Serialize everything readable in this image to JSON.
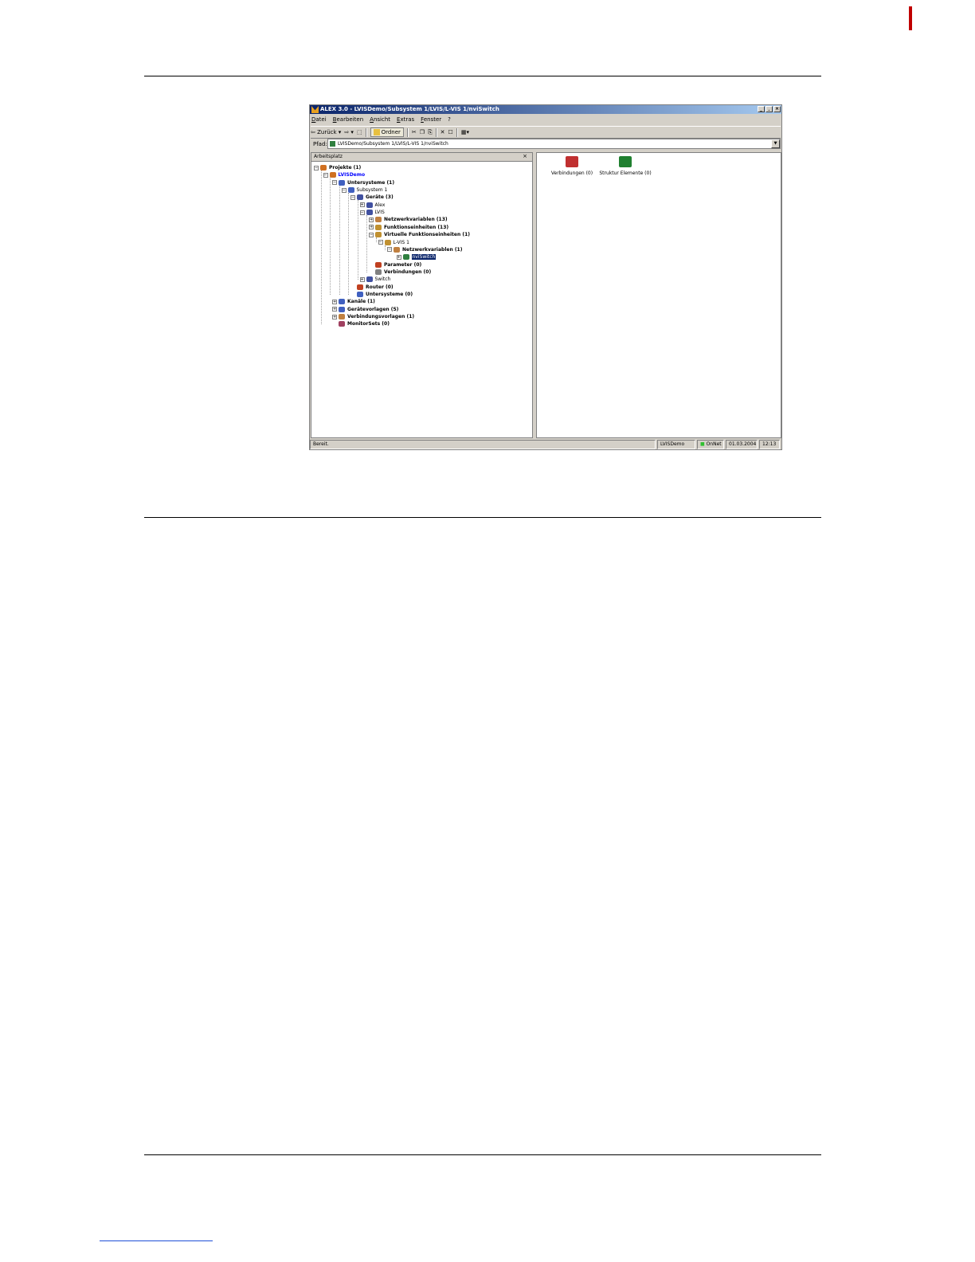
{
  "window": {
    "title": "ALEX 3.0 - LVISDemo/Subsystem 1/LVIS/L-VIS 1/nviSwitch",
    "controls": [
      "_",
      "¸",
      "×"
    ]
  },
  "menu": [
    "Datei",
    "Bearbeiten",
    "Ansicht",
    "Extras",
    "Fenster",
    "?"
  ],
  "toolbar": {
    "back": "Zurück",
    "ordner": "Ordner"
  },
  "address": {
    "label": "Pfad:",
    "value": "LVISDemo/Subsystem 1/LVIS/L-VIS 1/nviSwitch"
  },
  "left_pane": {
    "title": "Arbeitsplatz",
    "close": "×"
  },
  "tree": [
    {
      "label": "Projekte (1)",
      "bold": true,
      "expander": "−",
      "icon": "#d07020"
    },
    {
      "label": "LVISDemo",
      "bold": true,
      "blue": true,
      "expander": "−",
      "icon": "#d07020"
    },
    {
      "label": "Untersysteme (1)",
      "bold": true,
      "expander": "−",
      "icon": "#4060c0"
    },
    {
      "label": "Subsystem 1",
      "bold": false,
      "expander": "−",
      "icon": "#4060c0"
    },
    {
      "label": "Geräte (3)",
      "bold": true,
      "expander": "−",
      "icon": "#4050a0"
    },
    {
      "label": "Alex",
      "bold": false,
      "expander": "+",
      "icon": "#4050a0"
    },
    {
      "label": "LVIS",
      "bold": false,
      "expander": "−",
      "icon": "#4050a0"
    },
    {
      "label": "Netzwerkvariablen (13)",
      "bold": true,
      "expander": "+",
      "icon": "#c08040"
    },
    {
      "label": "Funktionseinheiten (13)",
      "bold": true,
      "expander": "+",
      "icon": "#c09030"
    },
    {
      "label": "Virtuelle Funktionseinheiten (1)",
      "bold": true,
      "expander": "−",
      "icon": "#c09030"
    },
    {
      "label": "L-VIS 1",
      "bold": false,
      "expander": "−",
      "icon": "#c09030"
    },
    {
      "label": "Netzwerkvariablen (1)",
      "bold": true,
      "expander": "−",
      "icon": "#c08040"
    },
    {
      "label": "nviSwitch",
      "bold": false,
      "selected": true,
      "expander": "+",
      "icon": "#308040"
    },
    {
      "label": "Parameter (0)",
      "bold": true,
      "expander": "",
      "icon": "#c04020"
    },
    {
      "label": "Verbindungen (0)",
      "bold": true,
      "expander": "",
      "icon": "#808080"
    },
    {
      "label": "Switch",
      "bold": false,
      "expander": "+",
      "icon": "#4050a0"
    },
    {
      "label": "Router (0)",
      "bold": true,
      "expander": "",
      "icon": "#c04020"
    },
    {
      "label": "Untersysteme (0)",
      "bold": true,
      "expander": "",
      "icon": "#4060c0"
    },
    {
      "label": "Kanäle (1)",
      "bold": true,
      "expander": "+",
      "icon": "#4060c0"
    },
    {
      "label": "Gerätevorlagen (5)",
      "bold": true,
      "expander": "+",
      "icon": "#4060c0"
    },
    {
      "label": "Verbindungsvorlagen (1)",
      "bold": true,
      "expander": "+",
      "icon": "#c08040"
    },
    {
      "label": "MonitorSets (0)",
      "bold": true,
      "expander": "",
      "icon": "#a04060"
    }
  ],
  "right_pane": {
    "items": [
      {
        "label": "Verbindungen (0)",
        "color": "#c03030"
      },
      {
        "label": "Struktur Elemente (0)",
        "color": "#208030"
      }
    ]
  },
  "status": {
    "text": "Bereit.",
    "project": "LVISDemo",
    "mode": "OnNet",
    "date": "01.03.2004",
    "time": "12:13"
  }
}
